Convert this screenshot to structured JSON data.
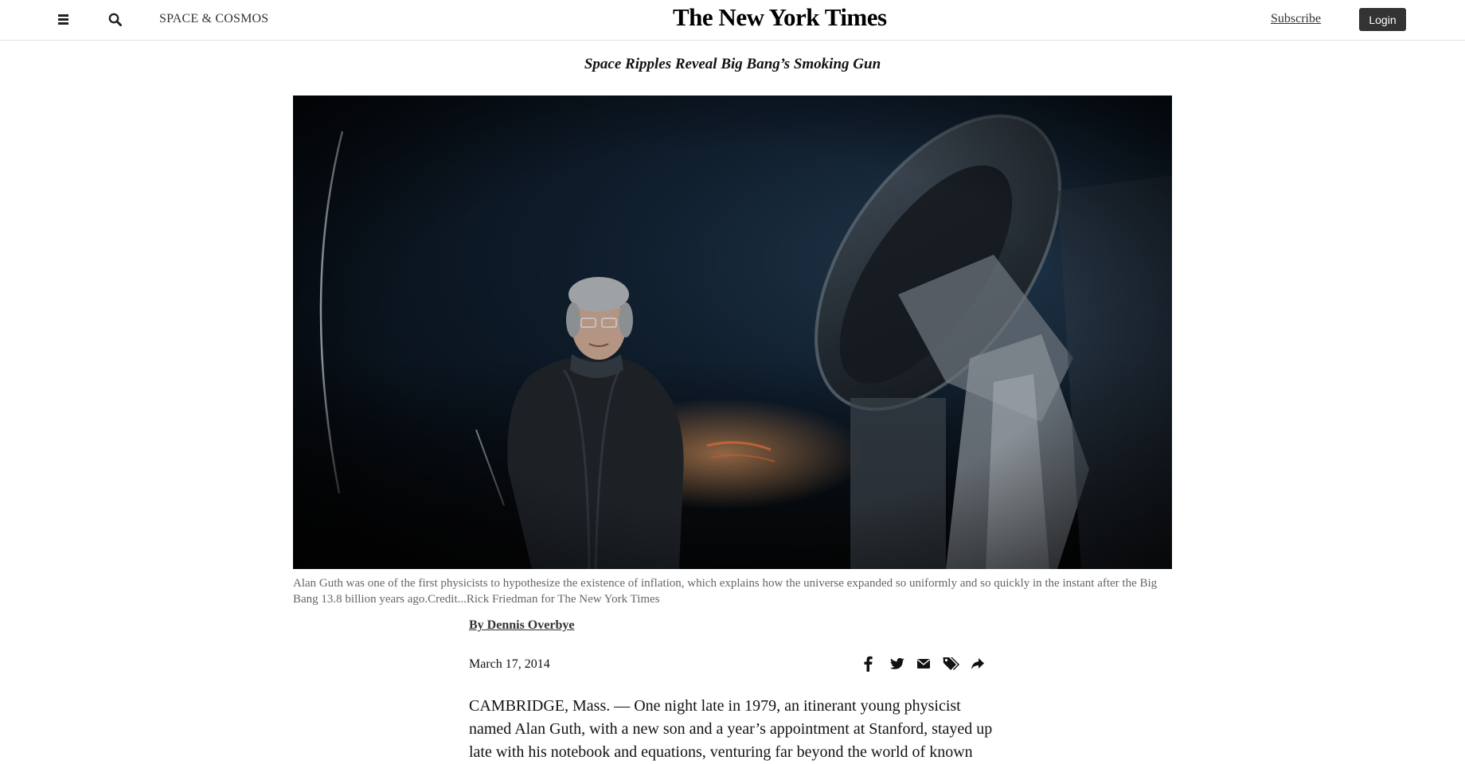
{
  "header": {
    "section": "SPACE & COSMOS",
    "logo": "The New York Times",
    "subscribe_label": "Subscribe",
    "login_label": "Login"
  },
  "article": {
    "headline": "Space Ripples Reveal Big Bang’s Smoking Gun",
    "caption": "Alan Guth was one of the first physicists to hypothesize the existence of inflation, which explains how the universe expanded so uniformly and so quickly in the instant after the Big Bang 13.8 billion years ago.Credit...Rick Friedman for The New York Times",
    "byline": "By Dennis Overbye",
    "date": "March 17, 2014",
    "body": "CAMBRIDGE, Mass. — One night late in 1979, an itinerant young physicist named Alan Guth, with a new son and a year’s appointment at Stanford, stayed up late with his notebook and equations, venturing far beyond the world of known"
  },
  "share_icons": [
    "facebook-icon",
    "twitter-icon",
    "email-icon",
    "tags-icon",
    "share-icon"
  ],
  "colors": {
    "login_bg": "#333333",
    "photo_sky": "#0f1d2c",
    "caption_text": "#666666"
  }
}
